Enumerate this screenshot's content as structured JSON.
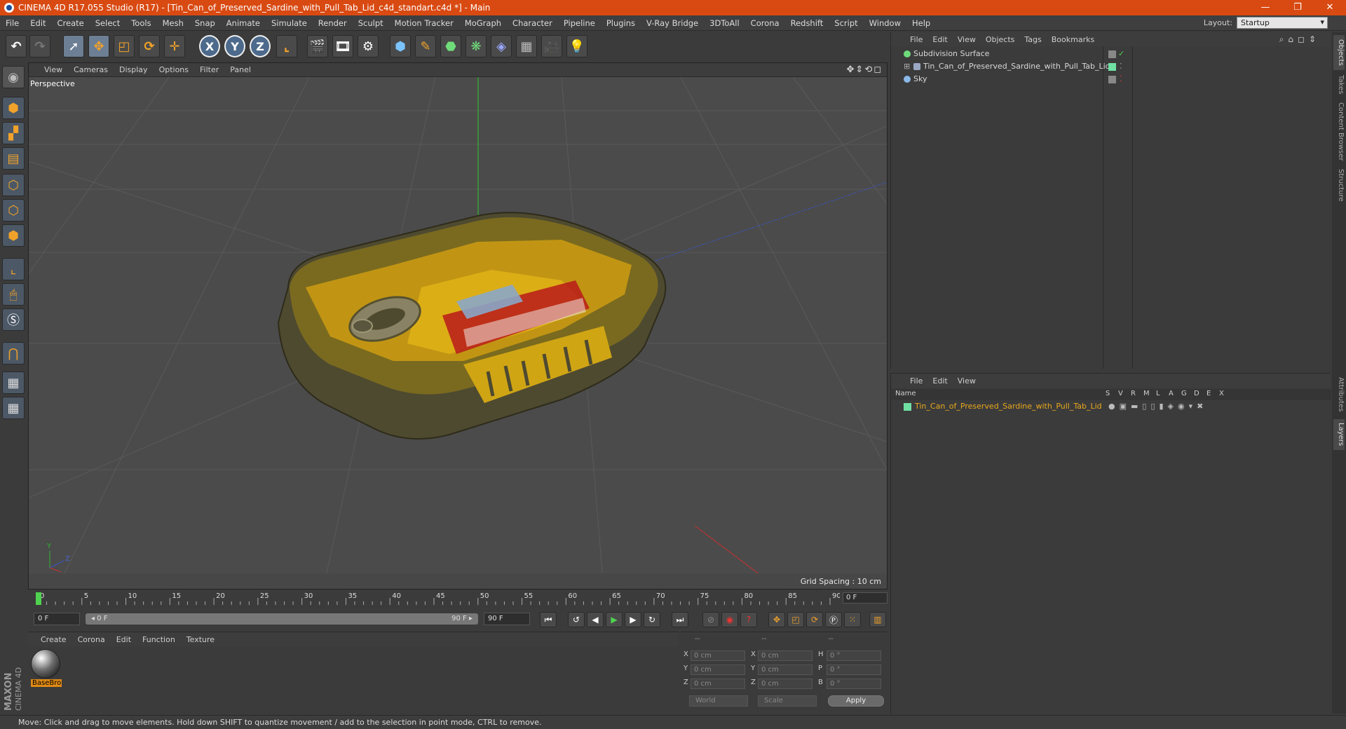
{
  "window": {
    "title": "CINEMA 4D R17.055 Studio (R17) - [Tin_Can_of_Preserved_Sardine_with_Pull_Tab_Lid_c4d_standart.c4d *] - Main",
    "controls": [
      "—",
      "❐",
      "✕"
    ]
  },
  "menubar": {
    "items": [
      "File",
      "Edit",
      "Create",
      "Select",
      "Tools",
      "Mesh",
      "Snap",
      "Animate",
      "Simulate",
      "Render",
      "Sculpt",
      "Motion Tracker",
      "MoGraph",
      "Character",
      "Pipeline",
      "Plugins",
      "V-Ray Bridge",
      "3DToAll",
      "Corona",
      "Redshift",
      "Script",
      "Window",
      "Help"
    ],
    "layout_label": "Layout:",
    "layout_value": "Startup"
  },
  "toolbar": {
    "axis_labels": [
      "X",
      "Y",
      "Z"
    ]
  },
  "viewport": {
    "menu": [
      "View",
      "Cameras",
      "Display",
      "Options",
      "Filter",
      "Panel"
    ],
    "nav_icons": "✥⇕⟲◻",
    "camera_label": "Perspective",
    "grid_spacing": "Grid Spacing : 10 cm",
    "axis_labels": {
      "y": "Y",
      "z": "Z"
    }
  },
  "timeline": {
    "ticks": [
      0,
      5,
      10,
      15,
      20,
      25,
      30,
      35,
      40,
      45,
      50,
      55,
      60,
      65,
      70,
      75,
      80,
      85,
      90
    ],
    "current_frame": "0 F"
  },
  "transport": {
    "start_field": "0 F",
    "slider_left": "◂ 0 F",
    "slider_right": "90 F ▸",
    "end_field": "90 F"
  },
  "material_manager": {
    "menu": [
      "Create",
      "Corona",
      "Edit",
      "Function",
      "Texture"
    ],
    "material_name": "BaseBro"
  },
  "coordinates": {
    "headers": [
      "--",
      "--",
      "--"
    ],
    "rows": [
      {
        "l1": "X",
        "v1": "0 cm",
        "l2": "X",
        "v2": "0 cm",
        "l3": "H",
        "v3": "0 °"
      },
      {
        "l1": "Y",
        "v1": "0 cm",
        "l2": "Y",
        "v2": "0 cm",
        "l3": "P",
        "v3": "0 °"
      },
      {
        "l1": "Z",
        "v1": "0 cm",
        "l2": "Z",
        "v2": "0 cm",
        "l3": "B",
        "v3": "0 °"
      }
    ],
    "mode_world": "World",
    "mode_scale": "Scale",
    "apply": "Apply"
  },
  "object_manager": {
    "menu": [
      "File",
      "Edit",
      "View",
      "Objects",
      "Tags",
      "Bookmarks"
    ],
    "objects": [
      {
        "name": "Subdivision Surface"
      },
      {
        "name": "Tin_Can_of_Preserved_Sardine_with_Pull_Tab_Lid"
      },
      {
        "name": "Sky"
      }
    ]
  },
  "layer_manager": {
    "menu": [
      "File",
      "Edit",
      "View"
    ],
    "columns": [
      "Name",
      "S",
      "V",
      "R",
      "M",
      "L",
      "A",
      "G",
      "D",
      "E",
      "X"
    ],
    "layer_name": "Tin_Can_of_Preserved_Sardine_with_Pull_Tab_Lid"
  },
  "right_tabs": [
    "Objects",
    "Takes",
    "Content Browser",
    "Structure",
    "Attributes",
    "Layers"
  ],
  "branding": {
    "line1": "MAXON",
    "line2": "CINEMA 4D"
  },
  "statusbar": {
    "text": "Move: Click and drag to move elements. Hold down SHIFT to quantize movement / add to the selection in point mode, CTRL to remove."
  },
  "colors": {
    "titlebar": "#d94a12",
    "accent_orange": "#e08a14",
    "layer_text": "#e8a81c",
    "layer_green": "#6fe0a2"
  }
}
